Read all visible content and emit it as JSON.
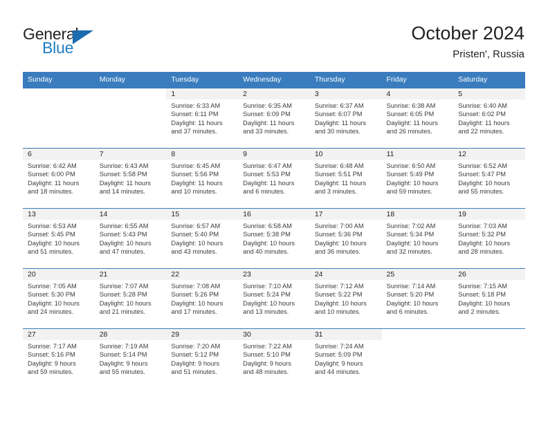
{
  "brand": {
    "word1": "General",
    "word2": "Blue",
    "logo_icon": "triangle-logo-icon",
    "accent_color": "#1f7fc4"
  },
  "header": {
    "title": "October 2024",
    "subtitle": "Pristen', Russia"
  },
  "theme": {
    "header_row_bg": "#3a7cbe",
    "daynum_band_bg": "#f2f2f2",
    "row_divider": "#3a7cbe",
    "text": "#231f20"
  },
  "calendar": {
    "weekday_headers": [
      "Sunday",
      "Monday",
      "Tuesday",
      "Wednesday",
      "Thursday",
      "Friday",
      "Saturday"
    ],
    "labels": {
      "sunrise": "Sunrise:",
      "sunset": "Sunset:",
      "daylight": "Daylight:"
    },
    "weeks": [
      [
        {
          "day": "",
          "sunrise": "",
          "sunset": "",
          "daylight_line1": "",
          "daylight_line2": "",
          "blank": true
        },
        {
          "day": "",
          "sunrise": "",
          "sunset": "",
          "daylight_line1": "",
          "daylight_line2": "",
          "blank": true
        },
        {
          "day": "1",
          "sunrise": "Sunrise: 6:33 AM",
          "sunset": "Sunset: 6:11 PM",
          "daylight_line1": "Daylight: 11 hours",
          "daylight_line2": "and 37 minutes."
        },
        {
          "day": "2",
          "sunrise": "Sunrise: 6:35 AM",
          "sunset": "Sunset: 6:09 PM",
          "daylight_line1": "Daylight: 11 hours",
          "daylight_line2": "and 33 minutes."
        },
        {
          "day": "3",
          "sunrise": "Sunrise: 6:37 AM",
          "sunset": "Sunset: 6:07 PM",
          "daylight_line1": "Daylight: 11 hours",
          "daylight_line2": "and 30 minutes."
        },
        {
          "day": "4",
          "sunrise": "Sunrise: 6:38 AM",
          "sunset": "Sunset: 6:05 PM",
          "daylight_line1": "Daylight: 11 hours",
          "daylight_line2": "and 26 minutes."
        },
        {
          "day": "5",
          "sunrise": "Sunrise: 6:40 AM",
          "sunset": "Sunset: 6:02 PM",
          "daylight_line1": "Daylight: 11 hours",
          "daylight_line2": "and 22 minutes."
        }
      ],
      [
        {
          "day": "6",
          "sunrise": "Sunrise: 6:42 AM",
          "sunset": "Sunset: 6:00 PM",
          "daylight_line1": "Daylight: 11 hours",
          "daylight_line2": "and 18 minutes."
        },
        {
          "day": "7",
          "sunrise": "Sunrise: 6:43 AM",
          "sunset": "Sunset: 5:58 PM",
          "daylight_line1": "Daylight: 11 hours",
          "daylight_line2": "and 14 minutes."
        },
        {
          "day": "8",
          "sunrise": "Sunrise: 6:45 AM",
          "sunset": "Sunset: 5:56 PM",
          "daylight_line1": "Daylight: 11 hours",
          "daylight_line2": "and 10 minutes."
        },
        {
          "day": "9",
          "sunrise": "Sunrise: 6:47 AM",
          "sunset": "Sunset: 5:53 PM",
          "daylight_line1": "Daylight: 11 hours",
          "daylight_line2": "and 6 minutes."
        },
        {
          "day": "10",
          "sunrise": "Sunrise: 6:48 AM",
          "sunset": "Sunset: 5:51 PM",
          "daylight_line1": "Daylight: 11 hours",
          "daylight_line2": "and 3 minutes."
        },
        {
          "day": "11",
          "sunrise": "Sunrise: 6:50 AM",
          "sunset": "Sunset: 5:49 PM",
          "daylight_line1": "Daylight: 10 hours",
          "daylight_line2": "and 59 minutes."
        },
        {
          "day": "12",
          "sunrise": "Sunrise: 6:52 AM",
          "sunset": "Sunset: 5:47 PM",
          "daylight_line1": "Daylight: 10 hours",
          "daylight_line2": "and 55 minutes."
        }
      ],
      [
        {
          "day": "13",
          "sunrise": "Sunrise: 6:53 AM",
          "sunset": "Sunset: 5:45 PM",
          "daylight_line1": "Daylight: 10 hours",
          "daylight_line2": "and 51 minutes."
        },
        {
          "day": "14",
          "sunrise": "Sunrise: 6:55 AM",
          "sunset": "Sunset: 5:43 PM",
          "daylight_line1": "Daylight: 10 hours",
          "daylight_line2": "and 47 minutes."
        },
        {
          "day": "15",
          "sunrise": "Sunrise: 6:57 AM",
          "sunset": "Sunset: 5:40 PM",
          "daylight_line1": "Daylight: 10 hours",
          "daylight_line2": "and 43 minutes."
        },
        {
          "day": "16",
          "sunrise": "Sunrise: 6:58 AM",
          "sunset": "Sunset: 5:38 PM",
          "daylight_line1": "Daylight: 10 hours",
          "daylight_line2": "and 40 minutes."
        },
        {
          "day": "17",
          "sunrise": "Sunrise: 7:00 AM",
          "sunset": "Sunset: 5:36 PM",
          "daylight_line1": "Daylight: 10 hours",
          "daylight_line2": "and 36 minutes."
        },
        {
          "day": "18",
          "sunrise": "Sunrise: 7:02 AM",
          "sunset": "Sunset: 5:34 PM",
          "daylight_line1": "Daylight: 10 hours",
          "daylight_line2": "and 32 minutes."
        },
        {
          "day": "19",
          "sunrise": "Sunrise: 7:03 AM",
          "sunset": "Sunset: 5:32 PM",
          "daylight_line1": "Daylight: 10 hours",
          "daylight_line2": "and 28 minutes."
        }
      ],
      [
        {
          "day": "20",
          "sunrise": "Sunrise: 7:05 AM",
          "sunset": "Sunset: 5:30 PM",
          "daylight_line1": "Daylight: 10 hours",
          "daylight_line2": "and 24 minutes."
        },
        {
          "day": "21",
          "sunrise": "Sunrise: 7:07 AM",
          "sunset": "Sunset: 5:28 PM",
          "daylight_line1": "Daylight: 10 hours",
          "daylight_line2": "and 21 minutes."
        },
        {
          "day": "22",
          "sunrise": "Sunrise: 7:08 AM",
          "sunset": "Sunset: 5:26 PM",
          "daylight_line1": "Daylight: 10 hours",
          "daylight_line2": "and 17 minutes."
        },
        {
          "day": "23",
          "sunrise": "Sunrise: 7:10 AM",
          "sunset": "Sunset: 5:24 PM",
          "daylight_line1": "Daylight: 10 hours",
          "daylight_line2": "and 13 minutes."
        },
        {
          "day": "24",
          "sunrise": "Sunrise: 7:12 AM",
          "sunset": "Sunset: 5:22 PM",
          "daylight_line1": "Daylight: 10 hours",
          "daylight_line2": "and 10 minutes."
        },
        {
          "day": "25",
          "sunrise": "Sunrise: 7:14 AM",
          "sunset": "Sunset: 5:20 PM",
          "daylight_line1": "Daylight: 10 hours",
          "daylight_line2": "and 6 minutes."
        },
        {
          "day": "26",
          "sunrise": "Sunrise: 7:15 AM",
          "sunset": "Sunset: 5:18 PM",
          "daylight_line1": "Daylight: 10 hours",
          "daylight_line2": "and 2 minutes."
        }
      ],
      [
        {
          "day": "27",
          "sunrise": "Sunrise: 7:17 AM",
          "sunset": "Sunset: 5:16 PM",
          "daylight_line1": "Daylight: 9 hours",
          "daylight_line2": "and 59 minutes."
        },
        {
          "day": "28",
          "sunrise": "Sunrise: 7:19 AM",
          "sunset": "Sunset: 5:14 PM",
          "daylight_line1": "Daylight: 9 hours",
          "daylight_line2": "and 55 minutes."
        },
        {
          "day": "29",
          "sunrise": "Sunrise: 7:20 AM",
          "sunset": "Sunset: 5:12 PM",
          "daylight_line1": "Daylight: 9 hours",
          "daylight_line2": "and 51 minutes."
        },
        {
          "day": "30",
          "sunrise": "Sunrise: 7:22 AM",
          "sunset": "Sunset: 5:10 PM",
          "daylight_line1": "Daylight: 9 hours",
          "daylight_line2": "and 48 minutes."
        },
        {
          "day": "31",
          "sunrise": "Sunrise: 7:24 AM",
          "sunset": "Sunset: 5:09 PM",
          "daylight_line1": "Daylight: 9 hours",
          "daylight_line2": "and 44 minutes."
        },
        {
          "day": "",
          "sunrise": "",
          "sunset": "",
          "daylight_line1": "",
          "daylight_line2": "",
          "blank": true
        },
        {
          "day": "",
          "sunrise": "",
          "sunset": "",
          "daylight_line1": "",
          "daylight_line2": "",
          "blank": true
        }
      ]
    ]
  }
}
